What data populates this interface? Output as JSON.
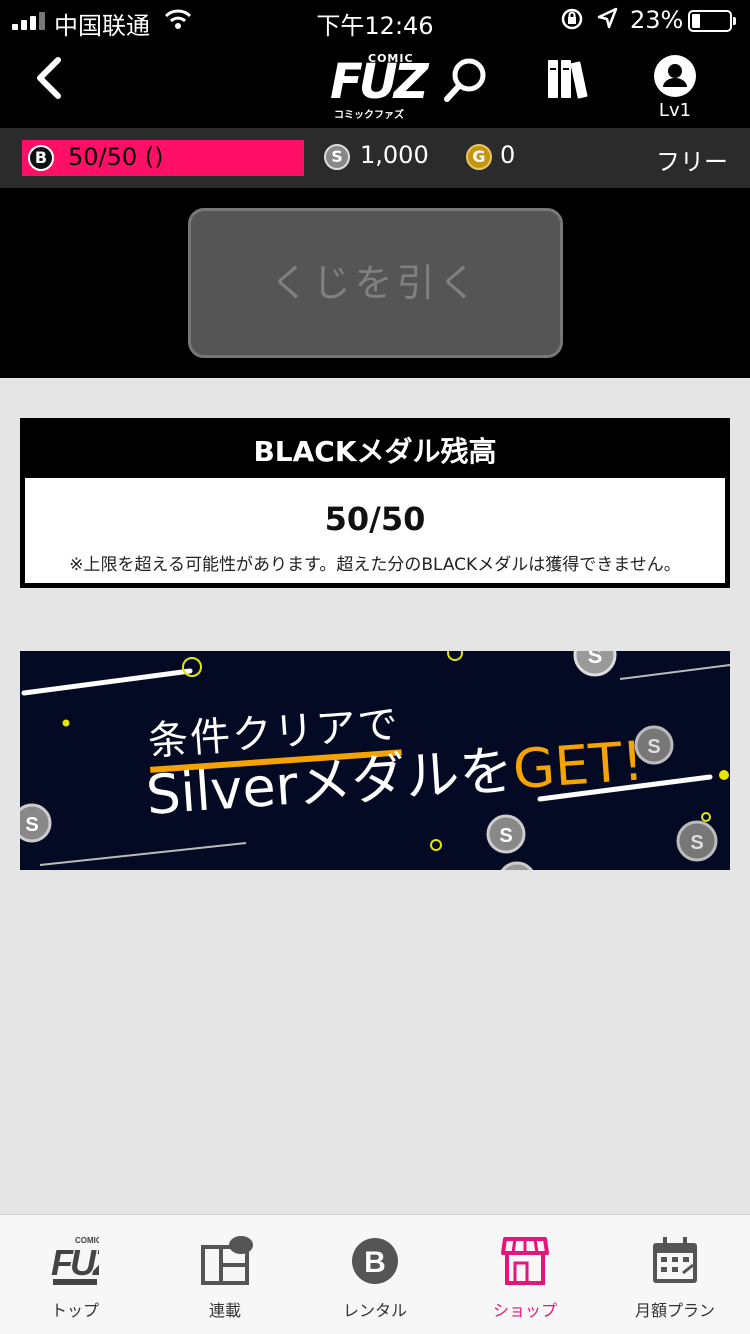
{
  "status_bar": {
    "carrier": "中国联通",
    "time": "下午12:46",
    "battery_percent": "23%",
    "battery_level": 0.23
  },
  "header": {
    "logo": {
      "comic": "COMIC",
      "fuz": "FUZ",
      "kana": "コミックファズ"
    },
    "level": "Lv1",
    "icons": [
      "back-icon",
      "search-icon",
      "bookshelf-icon",
      "profile-icon"
    ]
  },
  "medal_bar": {
    "black": {
      "coin": "B",
      "value": "50/50 ()"
    },
    "silver": {
      "coin": "S",
      "value": "1,000"
    },
    "gold": {
      "coin": "G",
      "value": "0"
    },
    "plan": "フリー"
  },
  "lottery": {
    "button_label": "くじを引く"
  },
  "balance": {
    "title": "BLACKメダル残高",
    "amount": "50/50",
    "note": "※上限を超える可能性があります。超えた分のBLACKメダルは獲得できません。"
  },
  "banner": {
    "line1": "条件クリアで",
    "line2_white": "Silverメダルを",
    "line2_orange": "GET!"
  },
  "tabs": [
    {
      "label": "トップ",
      "icon": "fuz-logo-icon",
      "active": false
    },
    {
      "label": "連載",
      "icon": "serial-icon",
      "active": false
    },
    {
      "label": "レンタル",
      "icon": "rental-b-icon",
      "active": false
    },
    {
      "label": "ショップ",
      "icon": "shop-icon",
      "active": true
    },
    {
      "label": "月額プラン",
      "icon": "calendar-icon",
      "active": false
    }
  ],
  "colors": {
    "accent_pink": "#ff1066",
    "active_tab": "#e6157a",
    "banner_bg": "#050a24",
    "banner_orange": "#f5a300"
  }
}
